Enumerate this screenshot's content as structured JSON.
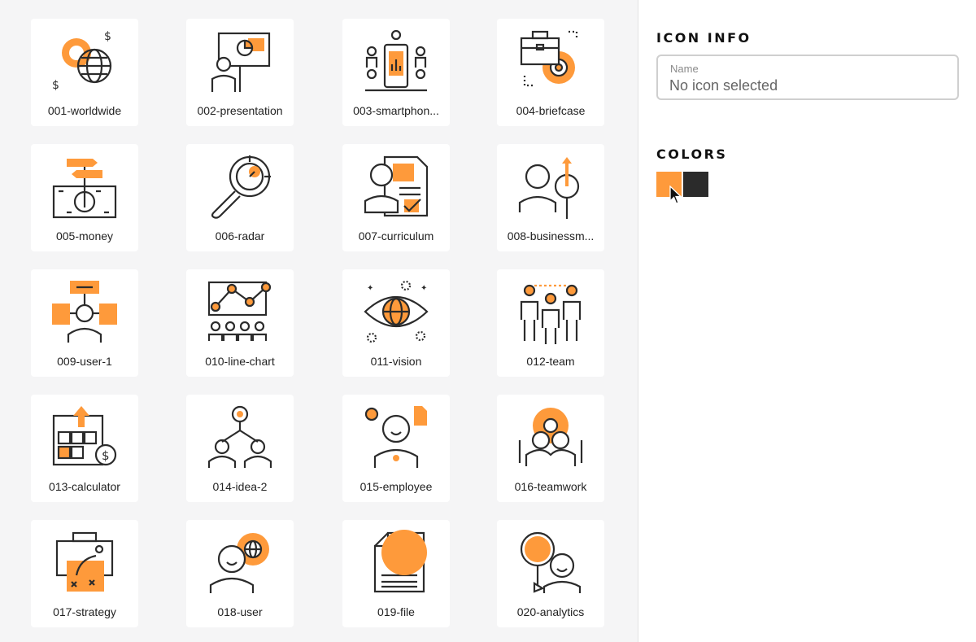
{
  "icons": [
    {
      "label": "001-worldwide"
    },
    {
      "label": "002-presentation"
    },
    {
      "label": "003-smartphon..."
    },
    {
      "label": "004-briefcase"
    },
    {
      "label": "005-money"
    },
    {
      "label": "006-radar"
    },
    {
      "label": "007-curriculum"
    },
    {
      "label": "008-businessm..."
    },
    {
      "label": "009-user-1"
    },
    {
      "label": "010-line-chart"
    },
    {
      "label": "011-vision"
    },
    {
      "label": "012-team"
    },
    {
      "label": "013-calculator"
    },
    {
      "label": "014-idea-2"
    },
    {
      "label": "015-employee"
    },
    {
      "label": "016-teamwork"
    },
    {
      "label": "017-strategy"
    },
    {
      "label": "018-user"
    },
    {
      "label": "019-file"
    },
    {
      "label": "020-analytics"
    }
  ],
  "panel": {
    "info_title": "ICON INFO",
    "name_label": "Name",
    "name_placeholder": "No icon selected",
    "colors_title": "COLORS",
    "colors": [
      "#fe9a3b",
      "#2b2b2b"
    ]
  }
}
